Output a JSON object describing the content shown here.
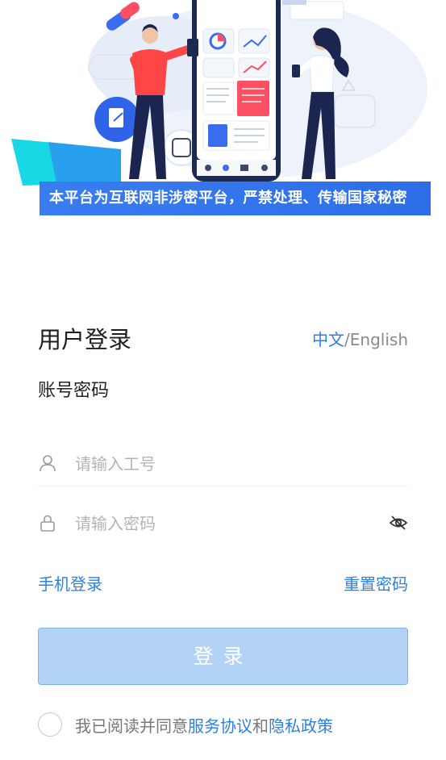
{
  "hero": {
    "banner_text": "本平台为互联网非涉密平台，严禁处理、传输国家秘密"
  },
  "login": {
    "title": "用户登录",
    "lang_active": "中文",
    "lang_separator": "/",
    "lang_other": "English",
    "subtitle": "账号密码",
    "username_placeholder": "请输入工号",
    "password_placeholder": "请输入密码",
    "phone_login_label": "手机登录",
    "reset_password_label": "重置密码",
    "submit_label": "登录"
  },
  "agreement": {
    "prefix": "我已阅读并同意",
    "service_link": "服务协议",
    "conjunction": "和",
    "privacy_link": "隐私政策"
  },
  "colors": {
    "accent": "#2f7fe0",
    "button_disabled": "#b3d3f6",
    "banner": "#3a7cf0"
  }
}
